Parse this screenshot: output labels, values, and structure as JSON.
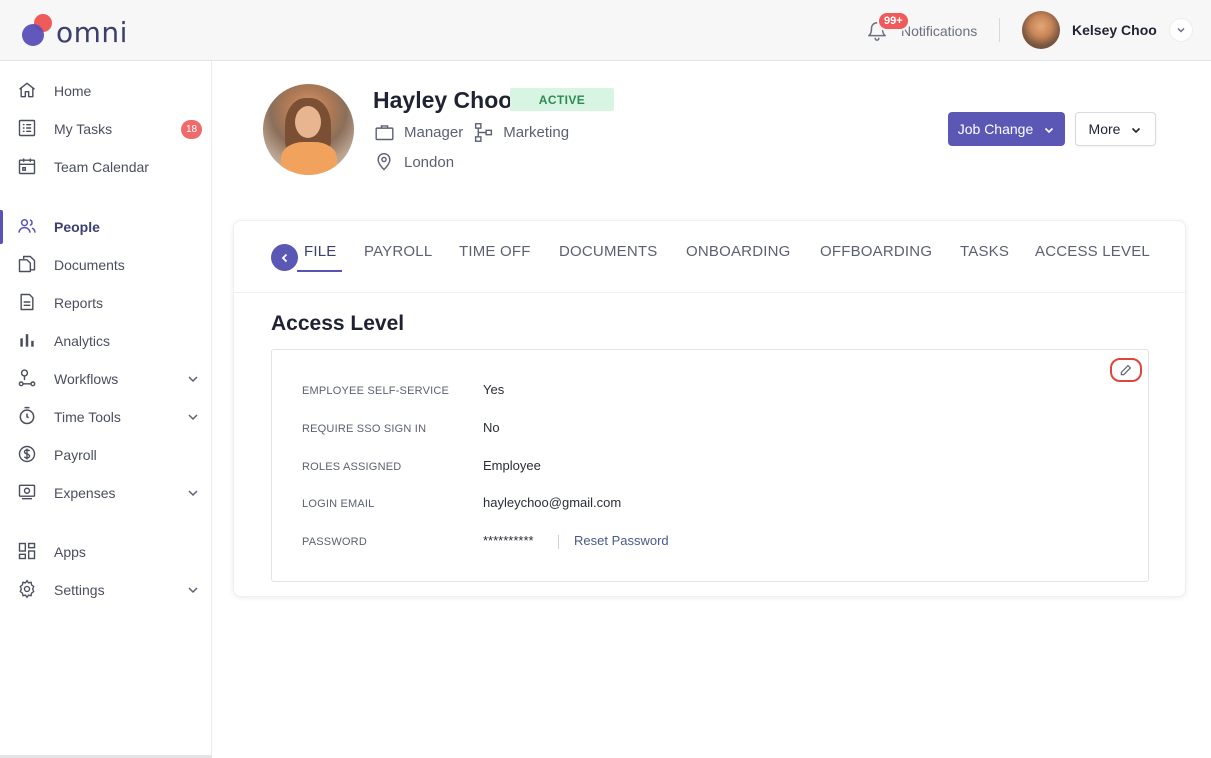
{
  "brand": {
    "name": "omni"
  },
  "topbar": {
    "notifications_badge": "99+",
    "notifications_label": "Notifications",
    "user_name": "Kelsey Choo"
  },
  "sidebar": {
    "items": [
      {
        "label": "Home",
        "icon": "home-icon"
      },
      {
        "label": "My Tasks",
        "icon": "tasks-icon",
        "count": "18"
      },
      {
        "label": "Team Calendar",
        "icon": "calendar-icon"
      },
      {
        "label": "People",
        "icon": "people-icon",
        "active": true
      },
      {
        "label": "Documents",
        "icon": "documents-icon"
      },
      {
        "label": "Reports",
        "icon": "reports-icon"
      },
      {
        "label": "Analytics",
        "icon": "analytics-icon"
      },
      {
        "label": "Workflows",
        "icon": "workflows-icon",
        "expandable": true
      },
      {
        "label": "Time Tools",
        "icon": "timer-icon",
        "expandable": true
      },
      {
        "label": "Payroll",
        "icon": "dollar-icon"
      },
      {
        "label": "Expenses",
        "icon": "expenses-icon",
        "expandable": true
      },
      {
        "label": "Apps",
        "icon": "apps-icon"
      },
      {
        "label": "Settings",
        "icon": "gear-icon",
        "expandable": true
      }
    ]
  },
  "profile": {
    "name": "Hayley Choo",
    "status": "ACTIVE",
    "role": "Manager",
    "department": "Marketing",
    "location": "London",
    "job_change_label": "Job Change",
    "more_label": "More"
  },
  "tabs": [
    {
      "label": "FILE",
      "active": true
    },
    {
      "label": "PAYROLL"
    },
    {
      "label": "TIME OFF"
    },
    {
      "label": "DOCUMENTS"
    },
    {
      "label": "ONBOARDING"
    },
    {
      "label": "OFFBOARDING"
    },
    {
      "label": "TASKS"
    },
    {
      "label": "ACCESS LEVEL"
    }
  ],
  "access_level": {
    "title": "Access Level",
    "fields": [
      {
        "key": "EMPLOYEE SELF-SERVICE",
        "value": "Yes"
      },
      {
        "key": "REQUIRE SSO SIGN IN",
        "value": "No"
      },
      {
        "key": "ROLES ASSIGNED",
        "value": "Employee"
      },
      {
        "key": "LOGIN EMAIL",
        "value": "hayleychoo@gmail.com"
      },
      {
        "key": "PASSWORD",
        "value": "**********",
        "action": "Reset Password"
      }
    ]
  },
  "colors": {
    "accent": "#5b57b5",
    "danger": "#ef5b5b",
    "active_bg": "#d8f5e4",
    "active_text": "#2d8a55"
  }
}
